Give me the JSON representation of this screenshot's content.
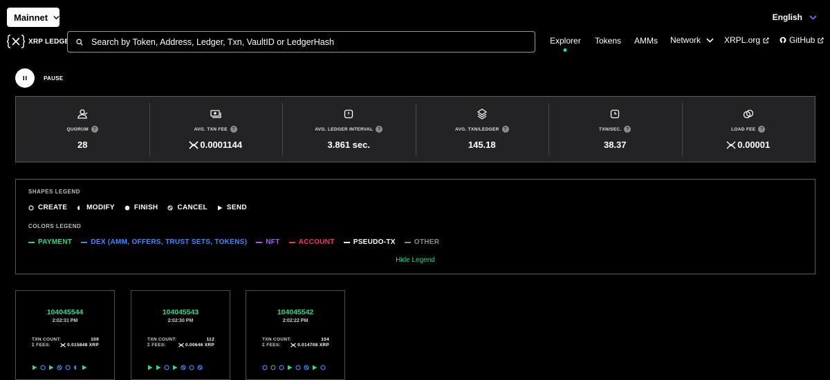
{
  "header": {
    "network": "Mainnet",
    "language": "English",
    "logo_text": "XRP LEDGER",
    "search_placeholder": "Search by Token, Address, Ledger, Txn, VaultID or LedgerHash"
  },
  "nav": {
    "explorer": "Explorer",
    "tokens": "Tokens",
    "amms": "AMMs",
    "network": "Network",
    "xrpl": "XRPL.org",
    "github": "GitHub"
  },
  "pause_label": "PAUSE",
  "metrics": [
    {
      "label": "QUORUM",
      "value": "28"
    },
    {
      "label": "AVG. TXN FEE",
      "value": "0.0001144"
    },
    {
      "label": "AVG. LEDGER INTERVAL",
      "value": "3.861 sec."
    },
    {
      "label": "AVG. TXN/LEDGER",
      "value": "145.18"
    },
    {
      "label": "TXN/SEC.",
      "value": "38.37"
    },
    {
      "label": "LOAD FEE",
      "value": "0.00001"
    }
  ],
  "legend": {
    "shapes_title": "SHAPES LEGEND",
    "shapes": [
      "CREATE",
      "MODIFY",
      "FINISH",
      "CANCEL",
      "SEND"
    ],
    "colors_title": "COLORS LEGEND",
    "colors": [
      {
        "label": "PAYMENT",
        "color": "#31d98a"
      },
      {
        "label": "DEX (AMM, OFFERS, TRUST SETS, TOKENS)",
        "color": "#3d8bff"
      },
      {
        "label": "NFT",
        "color": "#a65cff"
      },
      {
        "label": "ACCOUNT",
        "color": "#ff2e6a"
      },
      {
        "label": "PSEUDO-TX",
        "color": "#ffffff"
      },
      {
        "label": "OTHER",
        "color": "#8c8c8c"
      }
    ],
    "hide_label": "Hide Legend"
  },
  "ledgers": [
    {
      "number": "104045544",
      "time": "2:02:31 PM",
      "txn_count_label": "TXN COUNT:",
      "txn_count": "109",
      "fees_label": "Σ FEES:",
      "fees": "0.015848 XRP"
    },
    {
      "number": "104045543",
      "time": "2:02:30 PM",
      "txn_count_label": "TXN COUNT:",
      "txn_count": "112",
      "fees_label": "Σ FEES:",
      "fees": "0.00646 XRP"
    },
    {
      "number": "104045542",
      "time": "2:02:22 PM",
      "txn_count_label": "TXN COUNT:",
      "txn_count": "104",
      "fees_label": "Σ FEES:",
      "fees": "0.014708 XRP"
    }
  ],
  "icons": {
    "accent": "#31d98a",
    "chevron": "chevron-down-icon",
    "external": "external-link-icon"
  }
}
